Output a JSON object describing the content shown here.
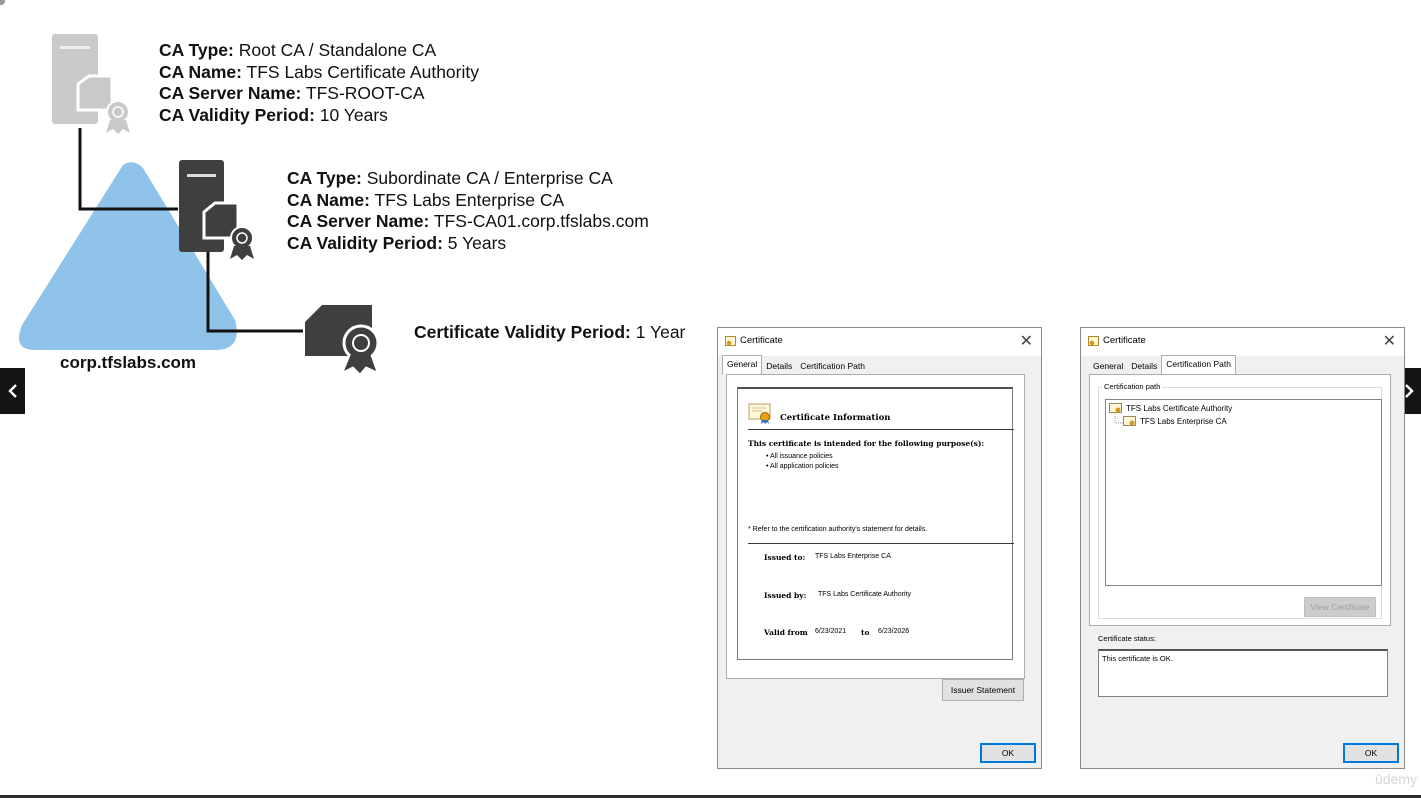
{
  "root_ca": {
    "type_label": "CA Type:",
    "type_value": " Root CA / Standalone CA",
    "name_label": "CA Name:",
    "name_value": " TFS Labs Certificate Authority",
    "server_label": "CA Server Name:",
    "server_value": " TFS-ROOT-CA",
    "validity_label": "CA Validity Period:",
    "validity_value": " 10 Years"
  },
  "sub_ca": {
    "type_label": "CA Type:",
    "type_value": " Subordinate CA / Enterprise CA",
    "name_label": "CA Name:",
    "name_value": " TFS Labs Enterprise CA",
    "server_label": "CA Server Name:",
    "server_value": " TFS-CA01.corp.tfslabs.com",
    "validity_label": "CA Validity Period:",
    "validity_value": " 5 Years"
  },
  "leaf_cert": {
    "validity_label": "Certificate Validity Period:",
    "validity_value": " 1 Year"
  },
  "domain": {
    "name": "corp.tfslabs.com"
  },
  "nav": {
    "prev": "‹",
    "next": "›"
  },
  "colors": {
    "domain_triangle": "#8fc3ea",
    "server_gray_light": "#c9c9c9",
    "server_gray_dark": "#3f3f3f",
    "dialog_bg": "#f0f0f0",
    "accent": "#0078d7"
  },
  "dialog_general": {
    "title": "Certificate",
    "tabs": [
      "General",
      "Details",
      "Certification Path"
    ],
    "active_tab": "General",
    "heading": "Certificate Information",
    "purpose": "This certificate is intended for the following purpose(s):",
    "bullets": [
      "• All issuance policies",
      "• All application policies"
    ],
    "note": "* Refer to the certification authority's statement for details.",
    "issued_to_label": "Issued to:",
    "issued_to": "TFS Labs Enterprise CA",
    "issued_by_label": "Issued by:",
    "issued_by": "TFS Labs Certificate Authority",
    "valid_from_label": "Valid from",
    "valid_from": "6/23/2021",
    "to_label": "to",
    "valid_to": "6/23/2026",
    "issuer_statement_button": "Issuer Statement",
    "ok_button": "OK"
  },
  "dialog_path": {
    "title": "Certificate",
    "tabs": [
      "General",
      "Details",
      "Certification Path"
    ],
    "active_tab": "Certification Path",
    "path_group_label": "Certification path",
    "tree": [
      "TFS Labs Certificate Authority",
      "TFS Labs Enterprise CA"
    ],
    "view_button": "View Certificate",
    "status_label": "Certificate status:",
    "status_text": "This certificate is OK.",
    "ok_button": "OK"
  },
  "watermark": "ūdemy"
}
